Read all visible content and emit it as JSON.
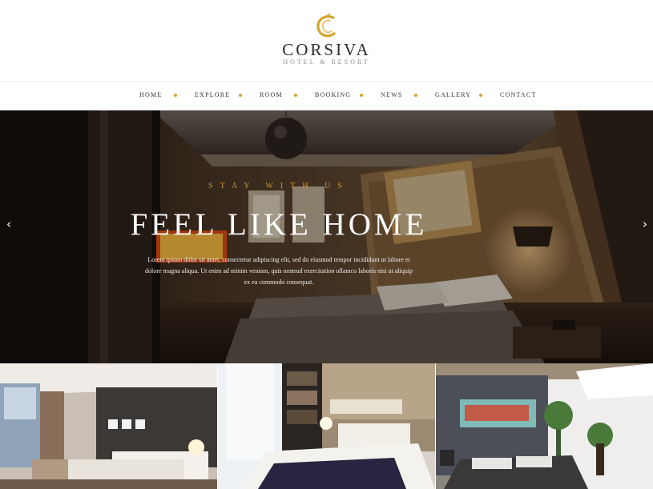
{
  "header": {
    "brand": "CORSIVA",
    "tagline": "HOTEL & RESORT",
    "logo_icon": "corsiva-c-logo-icon"
  },
  "nav": {
    "items": [
      {
        "label": "HOME"
      },
      {
        "label": "EXPLORE"
      },
      {
        "label": "ROOM"
      },
      {
        "label": "BOOKING"
      },
      {
        "label": "NEWS"
      },
      {
        "label": "GALLERY"
      },
      {
        "label": "CONTACT"
      }
    ],
    "separator_color": "#d4a62a"
  },
  "hero": {
    "kicker": "STAY WITH US",
    "title": "FEEL LIKE HOME",
    "text": "Lorem ipsum dolor sit amet, consectetur adipiscing elit, sed do eiusmod tempor incididunt ut labore et dolore magna aliqua. Ut enim ad minim veniam, quis nostrud exercitation ullamco laboris nisi ut aliquip ex ea commodo consequat.",
    "prev_icon": "chevron-left-icon",
    "next_icon": "chevron-right-icon",
    "accent_color": "#c99a3d"
  },
  "gallery": {
    "tiles": [
      {
        "image": "modern-white-bedroom-photo"
      },
      {
        "image": "bright-bedroom-with-bookshelf-photo"
      },
      {
        "image": "bedroom-with-padded-headboard-photo"
      }
    ]
  }
}
